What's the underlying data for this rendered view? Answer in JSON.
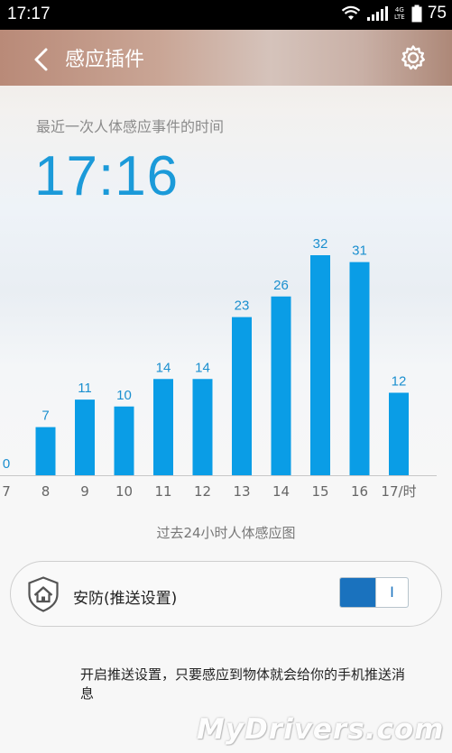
{
  "status_bar": {
    "time": "17:17",
    "network": "4G LTE",
    "battery": "75"
  },
  "app_bar": {
    "title": "感应插件"
  },
  "recent": {
    "label": "最近一次人体感应事件的时间",
    "time": "17:16"
  },
  "chart_data": {
    "type": "bar",
    "categories": [
      "7",
      "8",
      "9",
      "10",
      "11",
      "12",
      "13",
      "14",
      "15",
      "16",
      "17/时"
    ],
    "values": [
      0,
      7,
      11,
      10,
      14,
      14,
      23,
      26,
      32,
      31,
      12
    ],
    "title": "过去24小时人体感应图",
    "xlabel": "",
    "ylabel": "",
    "ylim": [
      0,
      32
    ],
    "bar_color": "#0a9de6"
  },
  "security": {
    "label": "安防(推送设置)",
    "toggle_on": true,
    "toggle_knob": "I"
  },
  "description": "开启推送设置，只要感应到物体就会给你的手机推送消息",
  "watermark": "MyDrivers.com",
  "colors": {
    "accent": "#1b9ad9",
    "toggle": "#1a72be"
  }
}
